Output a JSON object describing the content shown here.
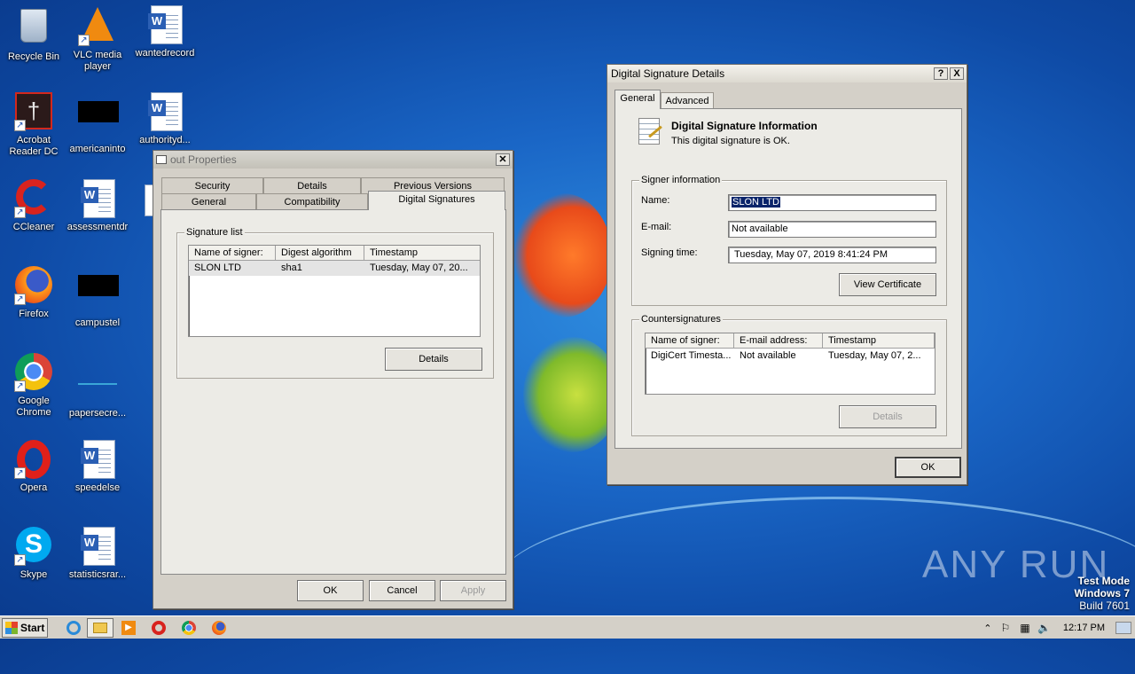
{
  "desktop": {
    "icons": [
      {
        "label": "Recycle Bin",
        "icon": "recycle-bin-icon"
      },
      {
        "label": "VLC media player",
        "icon": "vlc-icon"
      },
      {
        "label": "wantedrecord",
        "icon": "word-document-icon"
      },
      {
        "label": "Acrobat Reader DC",
        "icon": "acrobat-icon"
      },
      {
        "label": "americaninto",
        "icon": "black-file-icon"
      },
      {
        "label": "authorityd...",
        "icon": "word-document-icon"
      },
      {
        "label": "CCleaner",
        "icon": "ccleaner-icon"
      },
      {
        "label": "assessmentdr",
        "icon": "word-document-icon"
      },
      {
        "label": "Firefox",
        "icon": "firefox-icon"
      },
      {
        "label": "campustel",
        "icon": "black-file-icon"
      },
      {
        "label": "Google Chrome",
        "icon": "chrome-icon"
      },
      {
        "label": "papersecre...",
        "icon": "blank-file-icon"
      },
      {
        "label": "Opera",
        "icon": "opera-icon"
      },
      {
        "label": "speedelse",
        "icon": "word-document-icon"
      },
      {
        "label": "Skype",
        "icon": "skype-icon"
      },
      {
        "label": "statisticsrar...",
        "icon": "word-document-icon"
      }
    ]
  },
  "properties": {
    "title": "out Properties",
    "tabs_row1": [
      "Security",
      "Details",
      "Previous Versions"
    ],
    "tabs_row2": [
      "General",
      "Compatibility",
      "Digital Signatures"
    ],
    "active_tab": "Digital Signatures",
    "signature_list_label": "Signature list",
    "columns": [
      "Name of signer:",
      "Digest algorithm",
      "Timestamp"
    ],
    "rows": [
      [
        "SLON LTD",
        "sha1",
        "Tuesday, May 07, 20..."
      ]
    ],
    "details_button": "Details",
    "ok_button": "OK",
    "cancel_button": "Cancel",
    "apply_button": "Apply"
  },
  "sigdetails": {
    "title": "Digital Signature Details",
    "help": "?",
    "close": "X",
    "tabs": [
      "General",
      "Advanced"
    ],
    "active_tab": "General",
    "info_heading": "Digital Signature Information",
    "info_status": "This digital signature is OK.",
    "signer_group": "Signer information",
    "name_label": "Name:",
    "name_value": "SLON LTD",
    "email_label": "E-mail:",
    "email_value": "Not available",
    "time_label": "Signing time:",
    "time_value": "Tuesday,  May  07,  2019 8:41:24 PM",
    "view_cert_button": "View Certificate",
    "counter_group": "Countersignatures",
    "counter_columns": [
      "Name of signer:",
      "E-mail address:",
      "Timestamp"
    ],
    "counter_rows": [
      [
        "DigiCert Timesta...",
        "Not available",
        "Tuesday, May 07, 2..."
      ]
    ],
    "details_button": "Details",
    "ok_button": "OK"
  },
  "taskbar": {
    "start_label": "Start",
    "clock": "12:17 PM"
  },
  "watermark": {
    "line1": "Test Mode",
    "line2": "Windows 7",
    "line3": "Build 7601",
    "brand": "ANY RUN"
  },
  "colors": {
    "selection": "#0a246a",
    "dialog_bg": "#d4d0c8",
    "desktop_blue": "#1a66c6"
  }
}
